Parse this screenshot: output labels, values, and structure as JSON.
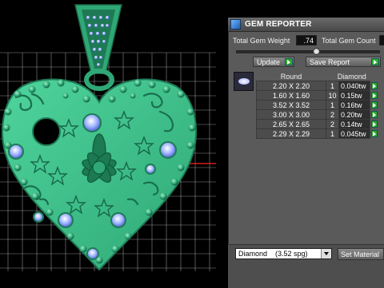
{
  "reporter": {
    "title": "GEM REPORTER",
    "total_weight_label": "Total Gem Weight",
    "total_weight_value": ".74",
    "total_count_label": "Total Gem Count",
    "update_label": "Update",
    "save_report_label": "Save Report",
    "column_round": "Round",
    "column_diamond": "Diamond",
    "rows": [
      {
        "size": "2.20 X 2.20",
        "count": "1",
        "weight": "0.040tw"
      },
      {
        "size": "1.60 X 1.60",
        "count": "10",
        "weight": "0.15tw"
      },
      {
        "size": "3.52 X 3.52",
        "count": "1",
        "weight": "0.16tw"
      },
      {
        "size": "3.00 X 3.00",
        "count": "2",
        "weight": "0.20tw"
      },
      {
        "size": "2.65 X 2.65",
        "count": "2",
        "weight": "0.14tw"
      },
      {
        "size": "2.29 X 2.29",
        "count": "1",
        "weight": "0.045tw"
      }
    ],
    "material_value": "Diamond    (3.52 spg)",
    "set_material_label": "Set Material"
  },
  "colors": {
    "metal": "#3ec08a",
    "metal_dark": "#1f7a56",
    "gem": "#8ea8ff",
    "grid": "#ffffff",
    "panel": "#5a5a5a",
    "action_green": "#2faa2f"
  }
}
